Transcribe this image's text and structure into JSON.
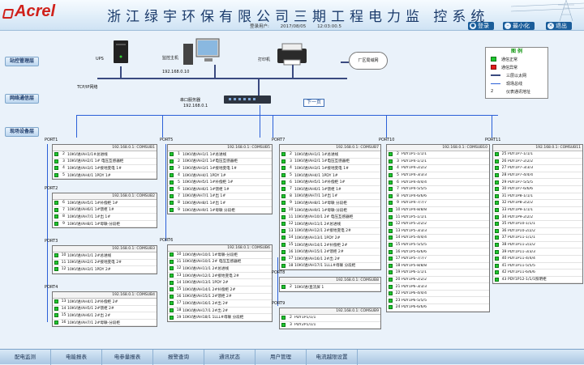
{
  "header": {
    "logo": "Acrel",
    "title": "浙江绿宇环保有限公司三期工程电力监 控系统",
    "login_label": "登录用户:",
    "date": "2017/08/05",
    "time": "12:03:00.5",
    "btn_login": "登录",
    "btn_min": "最小化",
    "btn_exit": "退出"
  },
  "levels": [
    "站控管理层",
    "网络通信层",
    "现场设备层"
  ],
  "devices": {
    "ups": "UPS",
    "server": "监控主机",
    "server_ip": "192.168.0.10",
    "printer": "打印机",
    "lan": "厂区局域网",
    "tcp": "TCP/IP网络",
    "converter": "串口服务器",
    "converter_ip": "192.168.0.1",
    "next": "下一页"
  },
  "legend": {
    "title": "图 例",
    "items": [
      "通信正常",
      "通信异常",
      "三层以太网",
      "现场总线",
      "仪表通讯地址"
    ],
    "addr_sample": "2"
  },
  "panels": [
    {
      "port": "PORT1",
      "com": "192.168.0.1: COMSUB1",
      "rows": [
        [
          "2",
          "10KV进/AH1/1#总进线"
        ],
        [
          "3",
          "10KV进/AH2/1 1# 电压互感器柜"
        ],
        [
          "4",
          "10KV进/AH3/1 1#接地变电 1#"
        ],
        [
          "5",
          "10KV进/AH4/1 1PDY 1#"
        ]
      ]
    },
    {
      "port": "PORT2",
      "com": "192.168.0.1: COMSUB2",
      "rows": [
        [
          "6",
          "10KV进/AH5/1 1#补偿柜 1#"
        ],
        [
          "7",
          "10KV进/AH6/1 1#馈柜 1#"
        ],
        [
          "8",
          "10KV进/AH7/1 1#出 1#"
        ],
        [
          "9",
          "10KV进/AH8/1 1#母联-分段柜"
        ]
      ]
    },
    {
      "port": "PORT3",
      "com": "192.168.0.1: COMSUB3",
      "rows": [
        [
          "10",
          "10KV进/AH1/1 2#总进线"
        ],
        [
          "11",
          "10KV进/AH2/1 2#接地变电 2#"
        ],
        [
          "12",
          "10KV进/AH3/1 1PDY 2#"
        ]
      ]
    },
    {
      "port": "PORT4",
      "com": "192.168.0.1: COMSUB4",
      "rows": [
        [
          "13",
          "10KV进/AH4/1 2#补偿柜 2#"
        ],
        [
          "14",
          "10KV进/AH5/1 2#馈柜 2#"
        ],
        [
          "15",
          "10KV进/AH6/1 2#出 2#"
        ],
        [
          "16",
          "10KV进/AH7/1 2#母联-分段柜"
        ]
      ]
    },
    {
      "port": "PORT5",
      "com": "192.168.0.1: COMSUB5",
      "rows": [
        [
          "1",
          "10KV进/AH1/1 1#总进线"
        ],
        [
          "2",
          "10KV进/AH2/1 1#电压互感器柜"
        ],
        [
          "3",
          "10KV进/AH3/1 1#接地变电 1#"
        ],
        [
          "4",
          "10KV进/AH4/1 1PDY 1#"
        ],
        [
          "5",
          "10KV进/AH5/1 1#补偿柜 1#"
        ],
        [
          "6",
          "10KV进/AH6/1 1#馈柜 1#"
        ],
        [
          "7",
          "10KV进/AH7/1 1#出 1#"
        ],
        [
          "8",
          "10KV进/AH8/1 1#出 1#"
        ],
        [
          "9",
          "10KV进/AH9/1 1#母联 分段柜"
        ]
      ]
    },
    {
      "port": "PORT6",
      "com": "192.168.0.1: COMSUB6",
      "rows": [
        [
          "10",
          "10KV进/AH10/1 1#母联-分段柜"
        ],
        [
          "11",
          "10KV进/AH10/1 2# 电压互感器柜"
        ],
        [
          "12",
          "10KV进/AH11/1 2#总进线"
        ],
        [
          "13",
          "10KV进/AH12/1 2#接地变电 2#"
        ],
        [
          "14",
          "10KV进/AH13/1 1PDY 2#"
        ],
        [
          "15",
          "10KV进/AH14/1 2#补偿柜 2#"
        ],
        [
          "16",
          "10KV进/AH15/1 2#馈柜 2#"
        ],
        [
          "17",
          "10KV进/AH16/1 2#出 2#"
        ],
        [
          "18",
          "10KV进/AH17/1 2#出 2#"
        ],
        [
          "19",
          "10KV进/AH18/1 1LLL#母联 分段柜"
        ]
      ]
    },
    {
      "port": "PORT7",
      "com": "192.168.0.1: COMSUB7",
      "rows": [
        [
          "2",
          "10KV进/AH1/1 1#总进线"
        ],
        [
          "3",
          "10KV进/AH2/1 1#电压互感器柜"
        ],
        [
          "4",
          "10KV进/AH3/1 1#接地变电 1#"
        ],
        [
          "5",
          "10KV进/AH4/1 1PDY 1#"
        ],
        [
          "6",
          "10KV进/AH5/1 1#补偿柜 1#"
        ],
        [
          "7",
          "10KV进/AH6/1 1#馈柜 1#"
        ],
        [
          "8",
          "10KV进/AH7/1 1#出 1#"
        ],
        [
          "9",
          "10KV进/AH8/1 1#母联 分段柜"
        ],
        [
          "10",
          "10KV进/AH9/1 1#母联-分段柜"
        ],
        [
          "11",
          "10KV进/AH10/1 2# 电压互感器柜"
        ],
        [
          "12",
          "10KV进/AH11/1 2#总进线"
        ],
        [
          "13",
          "10KV进/AH12/1 2#接地变电 2#"
        ],
        [
          "14",
          "10KV进/AH13/1 1PDY 2#"
        ],
        [
          "15",
          "10KV进/AH14/1 2#补偿柜 2#"
        ],
        [
          "16",
          "10KV进/AH15/1 2#馈柜 2#"
        ],
        [
          "17",
          "10KV进/AH16/1 2#出 2#"
        ],
        [
          "18",
          "10KV进/AH17/1 1LLL#母联 分段柜"
        ]
      ]
    },
    {
      "port": "PORT8",
      "com": "192.168.0.1: COMSUB8",
      "rows": [
        [
          "2",
          "10KV进/直流屏 1"
        ]
      ]
    },
    {
      "port": "PORT9",
      "com": "192.168.0.1: COMSUB9",
      "rows": [
        [
          "2",
          "PDY1P1/1/1"
        ],
        [
          "3",
          "PDY2P1/1/1"
        ]
      ]
    },
    {
      "port": "PORT10",
      "com": "192.168.0.1: COMSUB10",
      "rows": [
        [
          "2",
          "PDY1P1-1/1/1"
        ],
        [
          "3",
          "PDY1P4-1/1/1"
        ],
        [
          "4",
          "PDY1P4-2/2/2"
        ],
        [
          "5",
          "PDY1P4-3/3/3"
        ],
        [
          "6",
          "PDY1P4-4/4/4"
        ],
        [
          "7",
          "PDY1P4-5/5/5"
        ],
        [
          "8",
          "PDY1P4-6/6/6"
        ],
        [
          "9",
          "PDY1P4-7/7/7"
        ],
        [
          "10",
          "PDY1P4-8/8/8"
        ],
        [
          "11",
          "PDY1P5-1/1/1"
        ],
        [
          "12",
          "PDY1P5-2/2/2"
        ],
        [
          "13",
          "PDY1P5-3/3/3"
        ],
        [
          "14",
          "PDY1P5-4/4/4"
        ],
        [
          "15",
          "PDY1P5-5/5/5"
        ],
        [
          "16",
          "PDY1P5-6/6/6"
        ],
        [
          "17",
          "PDY1P5-7/7/7"
        ],
        [
          "18",
          "PDY1P5-8/8/8"
        ],
        [
          "19",
          "PDY1P6-1/1/1"
        ],
        [
          "20",
          "PDY1P6-2/2/2"
        ],
        [
          "21",
          "PDY1P6-3/3/3"
        ],
        [
          "22",
          "PDY1P6-4/4/4"
        ],
        [
          "23",
          "PDY1P6-5/5/5"
        ],
        [
          "24",
          "PDY1P6-6/6/6"
        ]
      ]
    },
    {
      "port": "PORT11",
      "com": "192.168.0.1: COMSUB11",
      "rows": [
        [
          "25",
          "PDY1P7-1/1/1"
        ],
        [
          "26",
          "PDY1P7-2/2/2"
        ],
        [
          "27",
          "PDY1P7-3/3/3"
        ],
        [
          "28",
          "PDY1P7-4/4/4"
        ],
        [
          "29",
          "PDY1P7-5/5/5"
        ],
        [
          "30",
          "PDY1P7-6/6/6"
        ],
        [
          "31",
          "PDY1P8-1/1/1"
        ],
        [
          "32",
          "PDY1P8-2/2/2"
        ],
        [
          "33",
          "PDY1P9-1/1/1"
        ],
        [
          "34",
          "PDY1P9-2/2/2"
        ],
        [
          "35",
          "PDY1P10-1/1/1"
        ],
        [
          "36",
          "PDY1P10-2/2/2"
        ],
        [
          "37",
          "PDY1P11-1/1/1"
        ],
        [
          "38",
          "PDY1P11-2/2/2"
        ],
        [
          "39",
          "PDY1P11-3/3/3"
        ],
        [
          "40",
          "PDY1P11-4/4/4"
        ],
        [
          "41",
          "PDY1P11-5/5/5"
        ],
        [
          "42",
          "PDY1P11-6/6/6"
        ],
        [
          "43",
          "PDY1P12-1/1/1照明柜"
        ]
      ]
    }
  ],
  "nav": [
    "配电监测",
    "电能报表",
    "电参量报表",
    "报警查询",
    "通讯状态",
    "用户管理",
    "电流越限设置"
  ]
}
